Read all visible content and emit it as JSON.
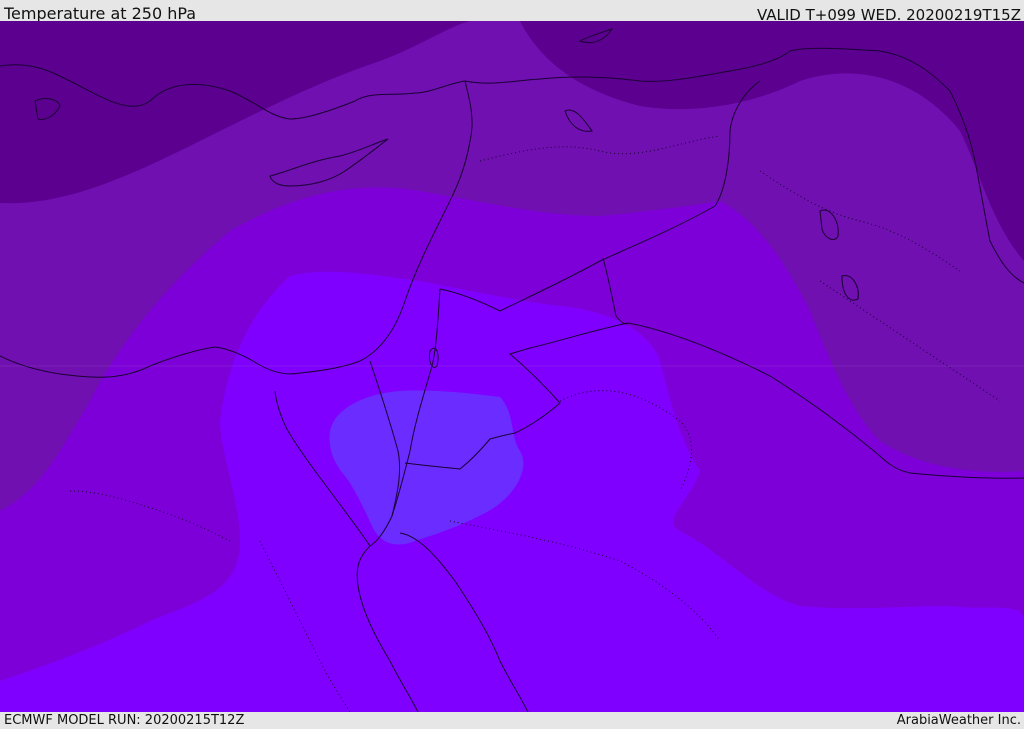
{
  "header": {
    "title": "Temperature at 250 hPa",
    "valid": "VALID T+099 WED. 20200219T15Z"
  },
  "footer": {
    "model_run": "ECMWF MODEL RUN: 20200215T12Z",
    "credit": "ArabiaWeather Inc."
  },
  "colors": {
    "darkest": "#5c0090",
    "dark": "#7010b0",
    "mid": "#7d00d8",
    "light": "#8000ff",
    "lightest": "#6a2cff",
    "coast": "#1a0033"
  }
}
